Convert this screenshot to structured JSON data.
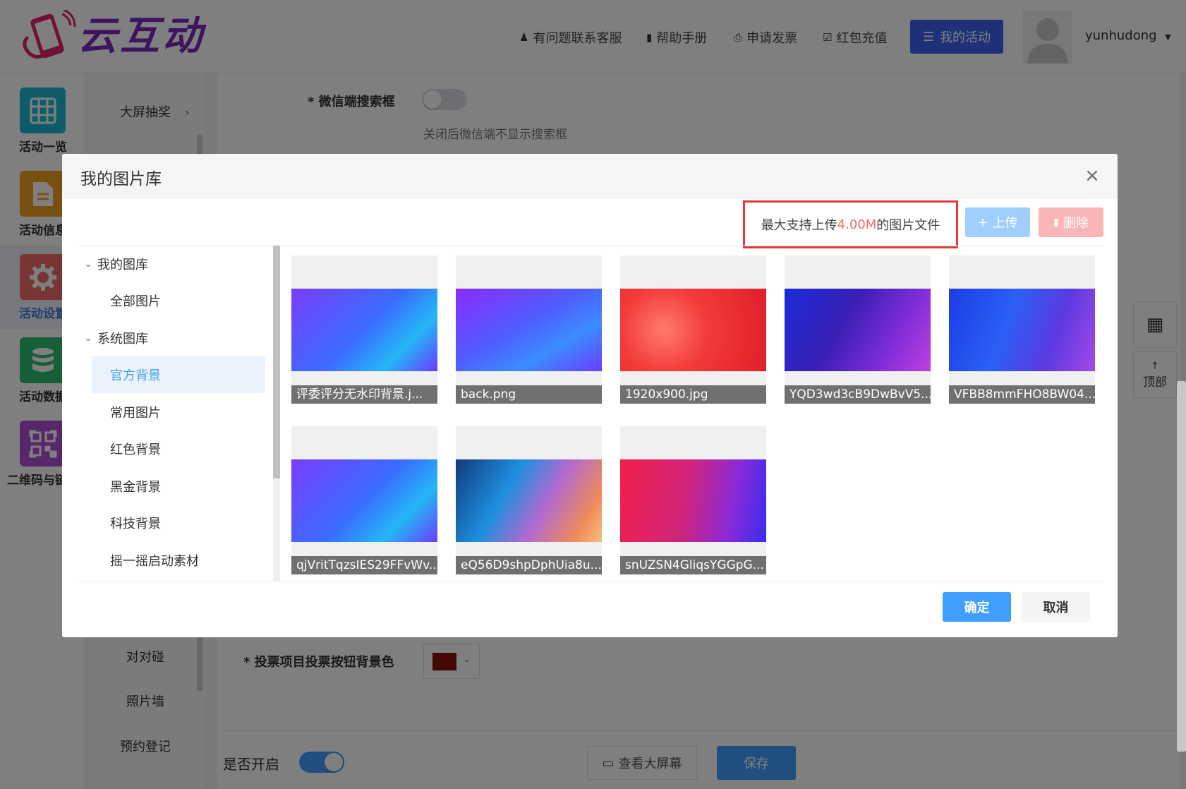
{
  "header": {
    "logo_text": "云互动",
    "links": [
      {
        "label": "有问题联系客服",
        "icon": "add-user-icon"
      },
      {
        "label": "帮助手册",
        "icon": "book-icon"
      },
      {
        "label": "申请发票",
        "icon": "printer-icon"
      },
      {
        "label": "红包充值",
        "icon": "shield-check-icon"
      }
    ],
    "my_activity": "我的活动",
    "username": "yunhudong"
  },
  "sidebar": {
    "items": [
      {
        "label": "活动一览",
        "icon": "grid-icon",
        "color": "#1fb7d6"
      },
      {
        "label": "活动信息",
        "icon": "document-icon",
        "color": "#f0a020"
      },
      {
        "label": "活动设置",
        "icon": "gear-icon",
        "color": "#f06a6a",
        "active": true
      },
      {
        "label": "活动数据",
        "icon": "database-icon",
        "color": "#2fbf71"
      },
      {
        "label": "二维码与链接",
        "icon": "qrcode-icon",
        "color": "#b04fd6"
      }
    ]
  },
  "submenu": {
    "items": [
      "大屏抽奖",
      "对对碰",
      "照片墙",
      "预约登记"
    ]
  },
  "main": {
    "search_label": "* 微信端搜索框",
    "search_hint": "关闭后微信端不显示搜索框",
    "vote_btn_label": "* 投票项目投票按钮背景色",
    "vote_btn_color": "#8b1010"
  },
  "footer": {
    "enable_label": "是否开启",
    "view_screen": "查看大屏幕",
    "save": "保存"
  },
  "float_tools": {
    "top_label": "顶部"
  },
  "modal": {
    "title": "我的图片库",
    "upload_hint_prefix": "最大支持上传",
    "upload_hint_size": "4.00M",
    "upload_hint_suffix": "的图片文件",
    "upload": "上传",
    "delete": "删除",
    "tree": [
      {
        "label": "我的图库",
        "level": 1,
        "expanded": true
      },
      {
        "label": "全部图片",
        "level": 2
      },
      {
        "label": "系统图库",
        "level": 1,
        "expanded": true
      },
      {
        "label": "官方背景",
        "level": 2,
        "selected": true
      },
      {
        "label": "常用图片",
        "level": 2
      },
      {
        "label": "红色背景",
        "level": 2
      },
      {
        "label": "黑金背景",
        "level": 2
      },
      {
        "label": "科技背景",
        "level": 2
      },
      {
        "label": "摇一摇启动素材",
        "level": 2
      }
    ],
    "images": [
      {
        "name": "评委评分无水印背景.j..."
      },
      {
        "name": "back.png"
      },
      {
        "name": "1920x900.jpg"
      },
      {
        "name": "YQD3wd3cB9DwBvV5..."
      },
      {
        "name": "VFBB8mmFHO8BW04..."
      },
      {
        "name": "qjVritTqzsIES29FFvWv..."
      },
      {
        "name": "eQ56D9shpDphUia8u..."
      },
      {
        "name": "snUZSN4GliqsYGGpG..."
      }
    ],
    "ok": "确定",
    "cancel": "取消"
  }
}
